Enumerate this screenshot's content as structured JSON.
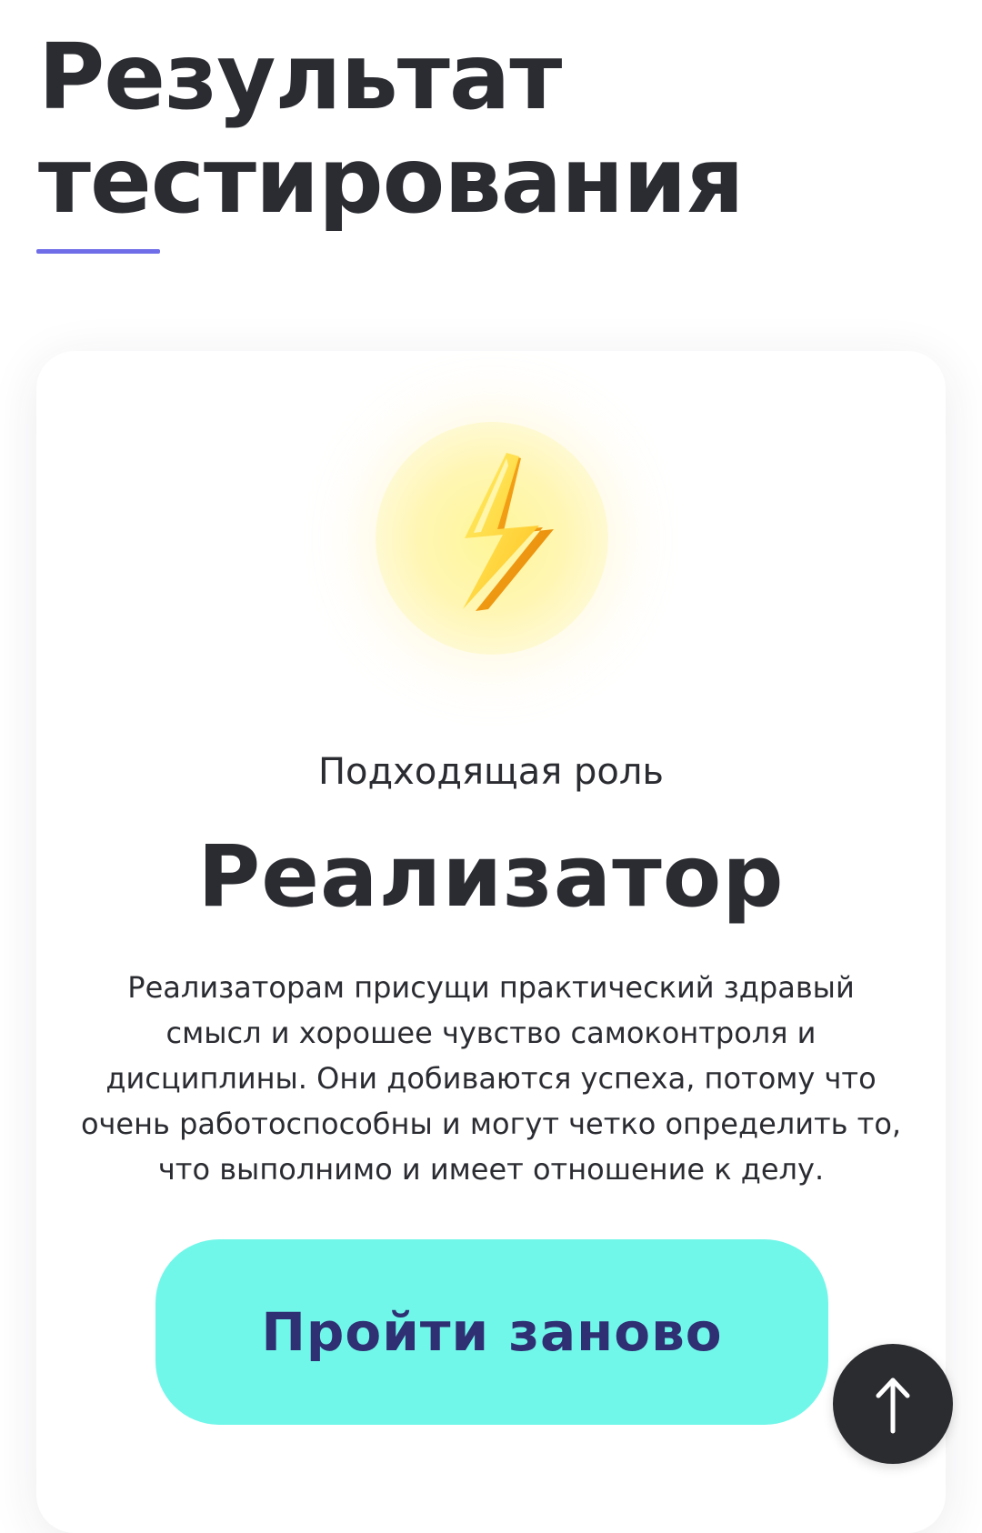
{
  "header": {
    "title_line1": "Результат",
    "title_line2": "тестирования"
  },
  "result": {
    "icon": "lightning-icon",
    "caption": "Подходящая роль",
    "role": "Реализатор",
    "description_lines": [
      "Реализаторам присущи практический здравый",
      "смысл и хорошее чувство самоконтроля и",
      "дисциплины. Они добиваются успеха, потому что",
      "очень работоспособны и могут четко определить то,",
      "что выполнимо и имеет отношение к делу."
    ],
    "retry_label": "Пройти заново"
  },
  "scroll_top": {
    "icon": "arrow-up-icon"
  },
  "colors": {
    "text": "#2b2c32",
    "accent_underline": "#6f6ee8",
    "button_bg": "#71f7e9",
    "button_text": "#2f2f73",
    "scroll_button_bg": "#2b2c30"
  }
}
